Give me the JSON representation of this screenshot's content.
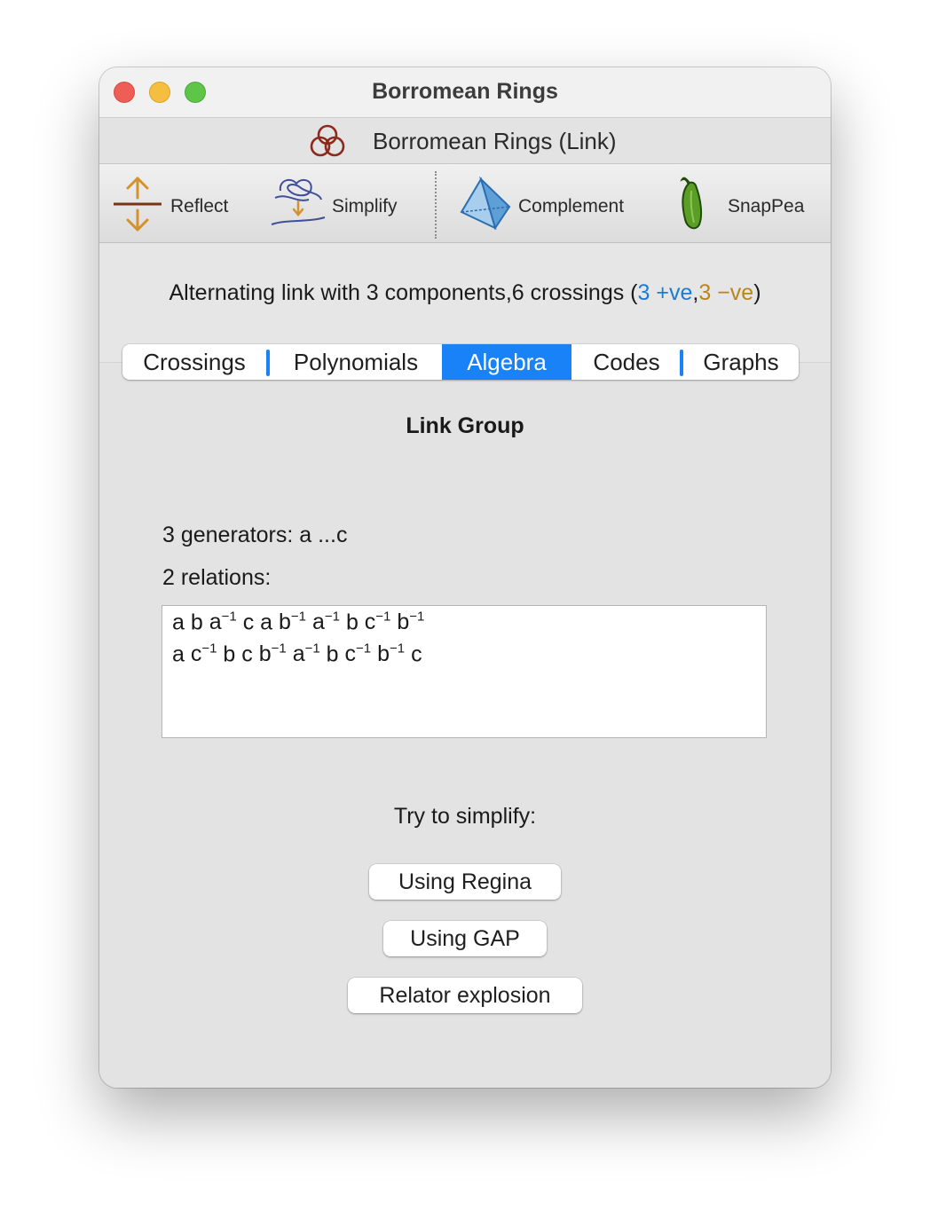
{
  "window": {
    "title": "Borromean Rings"
  },
  "subheader": {
    "title": "Borromean Rings (Link)",
    "icon": "borromean-knot-icon"
  },
  "toolbar": {
    "reflect_label": "Reflect",
    "simplify_label": "Simplify",
    "complement_label": "Complement",
    "snappea_label": "SnapPea"
  },
  "summary": {
    "prefix": "Alternating link with 3 components,6 crossings (",
    "positive": "3 +ve",
    "separator": ",",
    "negative": "3 −ve",
    "suffix": ")",
    "positive_color": "#1d7bd0",
    "negative_color": "#b9861b"
  },
  "tabs": [
    "Crossings",
    "Polynomials",
    "Algebra",
    "Codes",
    "Graphs"
  ],
  "active_tab": "Algebra",
  "accent_color": "#1a82f7",
  "algebra": {
    "heading": "Link Group",
    "generators": "3 generators: a ...c",
    "relations_label": "2 relations:",
    "relations": [
      [
        [
          "a",
          ""
        ],
        [
          "b",
          ""
        ],
        [
          "a",
          "−1"
        ],
        [
          "c",
          ""
        ],
        [
          "a",
          ""
        ],
        [
          "b",
          "−1"
        ],
        [
          "a",
          "−1"
        ],
        [
          "b",
          ""
        ],
        [
          "c",
          "−1"
        ],
        [
          "b",
          "−1"
        ]
      ],
      [
        [
          "a",
          ""
        ],
        [
          "c",
          "−1"
        ],
        [
          "b",
          ""
        ],
        [
          "c",
          ""
        ],
        [
          "b",
          "−1"
        ],
        [
          "a",
          "−1"
        ],
        [
          "b",
          ""
        ],
        [
          "c",
          "−1"
        ],
        [
          "b",
          "−1"
        ],
        [
          "c",
          ""
        ]
      ]
    ],
    "simplify_label": "Try to simplify:",
    "buttons": {
      "regina": "Using Regina",
      "gap": "Using GAP",
      "explosion": "Relator explosion"
    }
  }
}
